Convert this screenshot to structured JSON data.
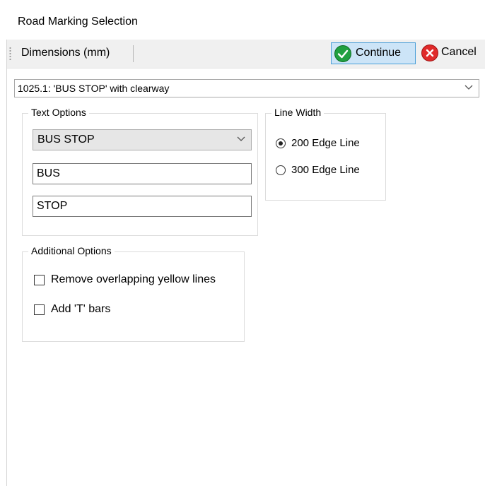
{
  "window": {
    "title": "Road Marking Selection"
  },
  "toolbar": {
    "dimensions_label": "Dimensions (mm)",
    "continue_label": "Continue",
    "cancel_label": "Cancel",
    "icons": {
      "continue": "check-circle-icon",
      "cancel": "close-circle-icon"
    },
    "colors": {
      "continue_icon": "#20a040",
      "cancel_icon": "#e02a2a",
      "continue_bg": "#cce4f7"
    }
  },
  "marking_select": {
    "value": "1025.1: 'BUS STOP' with clearway"
  },
  "text_options": {
    "legend": "Text Options",
    "preset_value": "BUS STOP",
    "line1": "BUS",
    "line2": "STOP"
  },
  "line_width": {
    "legend": "Line Width",
    "options": [
      {
        "label": "200 Edge Line",
        "selected": true
      },
      {
        "label": "300 Edge Line",
        "selected": false
      }
    ]
  },
  "additional_options": {
    "legend": "Additional Options",
    "options": [
      {
        "label": "Remove overlapping yellow lines",
        "checked": false
      },
      {
        "label": "Add 'T' bars",
        "checked": false
      }
    ]
  }
}
